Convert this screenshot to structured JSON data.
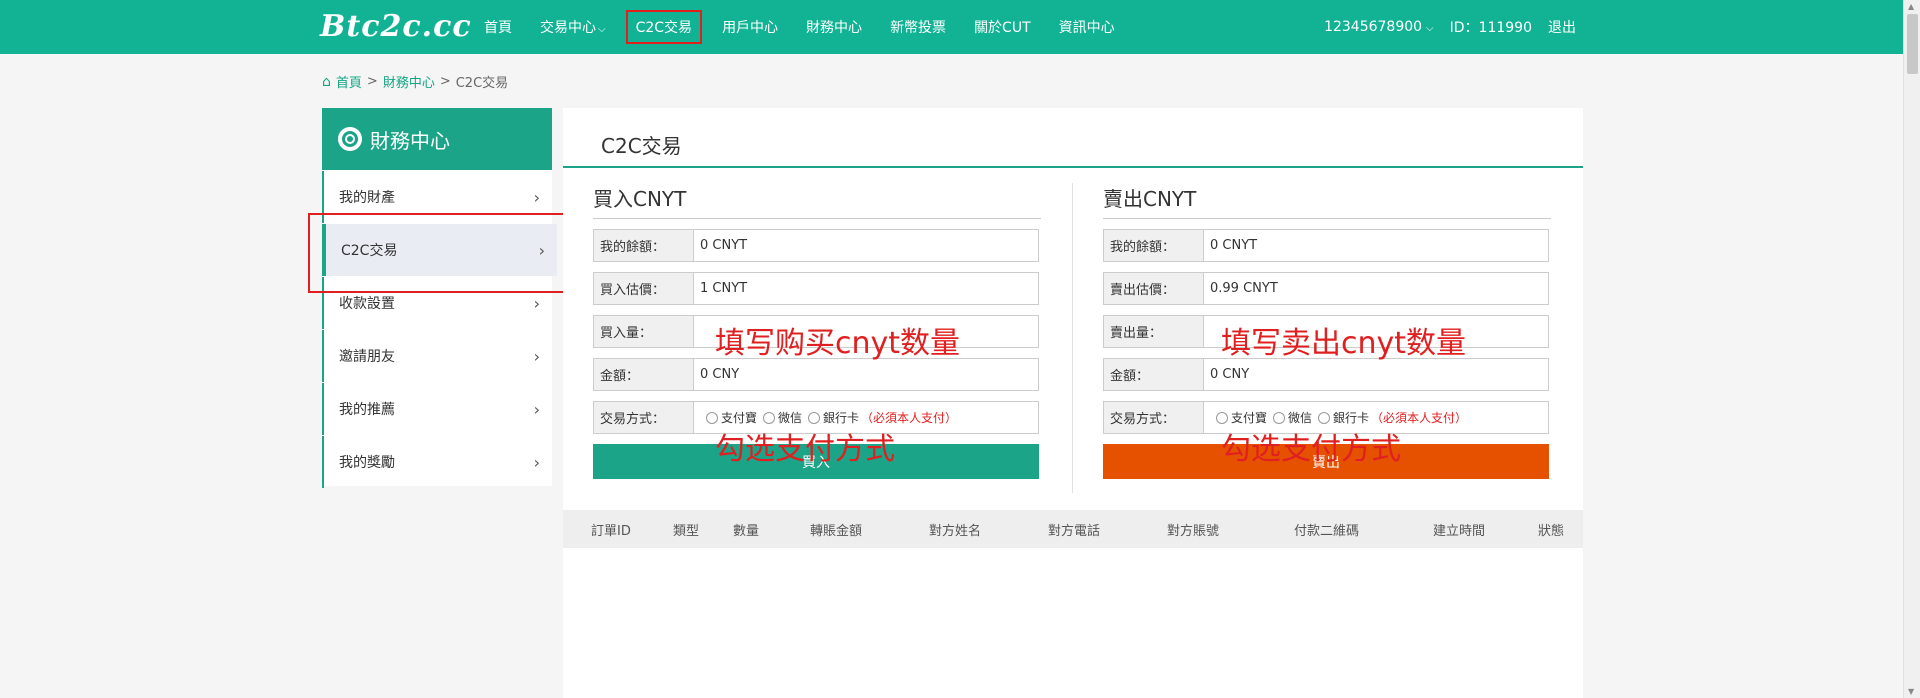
{
  "brand": {
    "logo_text": "Btc2c.cc",
    "accent": "#12b394",
    "sidebar_accent": "#1ba487",
    "sell_color": "#e65100",
    "annotation_color": "#e02020"
  },
  "nav": {
    "items": [
      {
        "label": "首頁"
      },
      {
        "label": "交易中心",
        "has_dropdown": true
      },
      {
        "label": "C2C交易",
        "active": true
      },
      {
        "label": "用戶中心"
      },
      {
        "label": "財務中心"
      },
      {
        "label": "新幣投票"
      },
      {
        "label": "關於CUT"
      },
      {
        "label": "資訊中心"
      }
    ],
    "account": "12345678900",
    "user_id": "ID：111990",
    "logout": "退出"
  },
  "breadcrumb": {
    "home": "首頁",
    "level1": "財務中心",
    "current": "C2C交易",
    "sep": ">"
  },
  "sidebar": {
    "title": "財務中心",
    "items": [
      {
        "label": "我的財產"
      },
      {
        "label": "C2C交易",
        "active": true
      },
      {
        "label": "收款設置"
      },
      {
        "label": "邀請朋友"
      },
      {
        "label": "我的推薦"
      },
      {
        "label": "我的獎勵"
      }
    ]
  },
  "main": {
    "title": "C2C交易",
    "buy": {
      "title": "買入CNYT",
      "balance_label": "我的餘額：",
      "balance_value": "0 CNYT",
      "price_label": "買入估價：",
      "price_value": "1 CNYT",
      "amount_label": "買入量：",
      "amount_value": "",
      "total_label": "金額：",
      "total_value": "0 CNY",
      "pay_label": "交易方式：",
      "pay_options": [
        "支付寶",
        "微信",
        "銀行卡"
      ],
      "pay_note": "（必須本人支付）",
      "button": "買入",
      "annotation_amount": "填写购买cnyt数量",
      "annotation_pay": "勾选支付方式"
    },
    "sell": {
      "title": "賣出CNYT",
      "balance_label": "我的餘額：",
      "balance_value": "0 CNYT",
      "price_label": "賣出估價：",
      "price_value": "0.99 CNYT",
      "amount_label": "賣出量：",
      "amount_value": "",
      "total_label": "金額：",
      "total_value": "0 CNY",
      "pay_label": "交易方式：",
      "pay_options": [
        "支付寶",
        "微信",
        "銀行卡"
      ],
      "pay_note": "（必須本人支付）",
      "button": "賣出",
      "annotation_amount": "填写卖出cnyt数量",
      "annotation_pay": "勾选支付方式"
    },
    "orders": {
      "columns": [
        "訂單ID",
        "類型",
        "數量",
        "轉賬金額",
        "對方姓名",
        "對方電話",
        "對方賬號",
        "付款二維碼",
        "建立時間",
        "狀態"
      ]
    }
  }
}
